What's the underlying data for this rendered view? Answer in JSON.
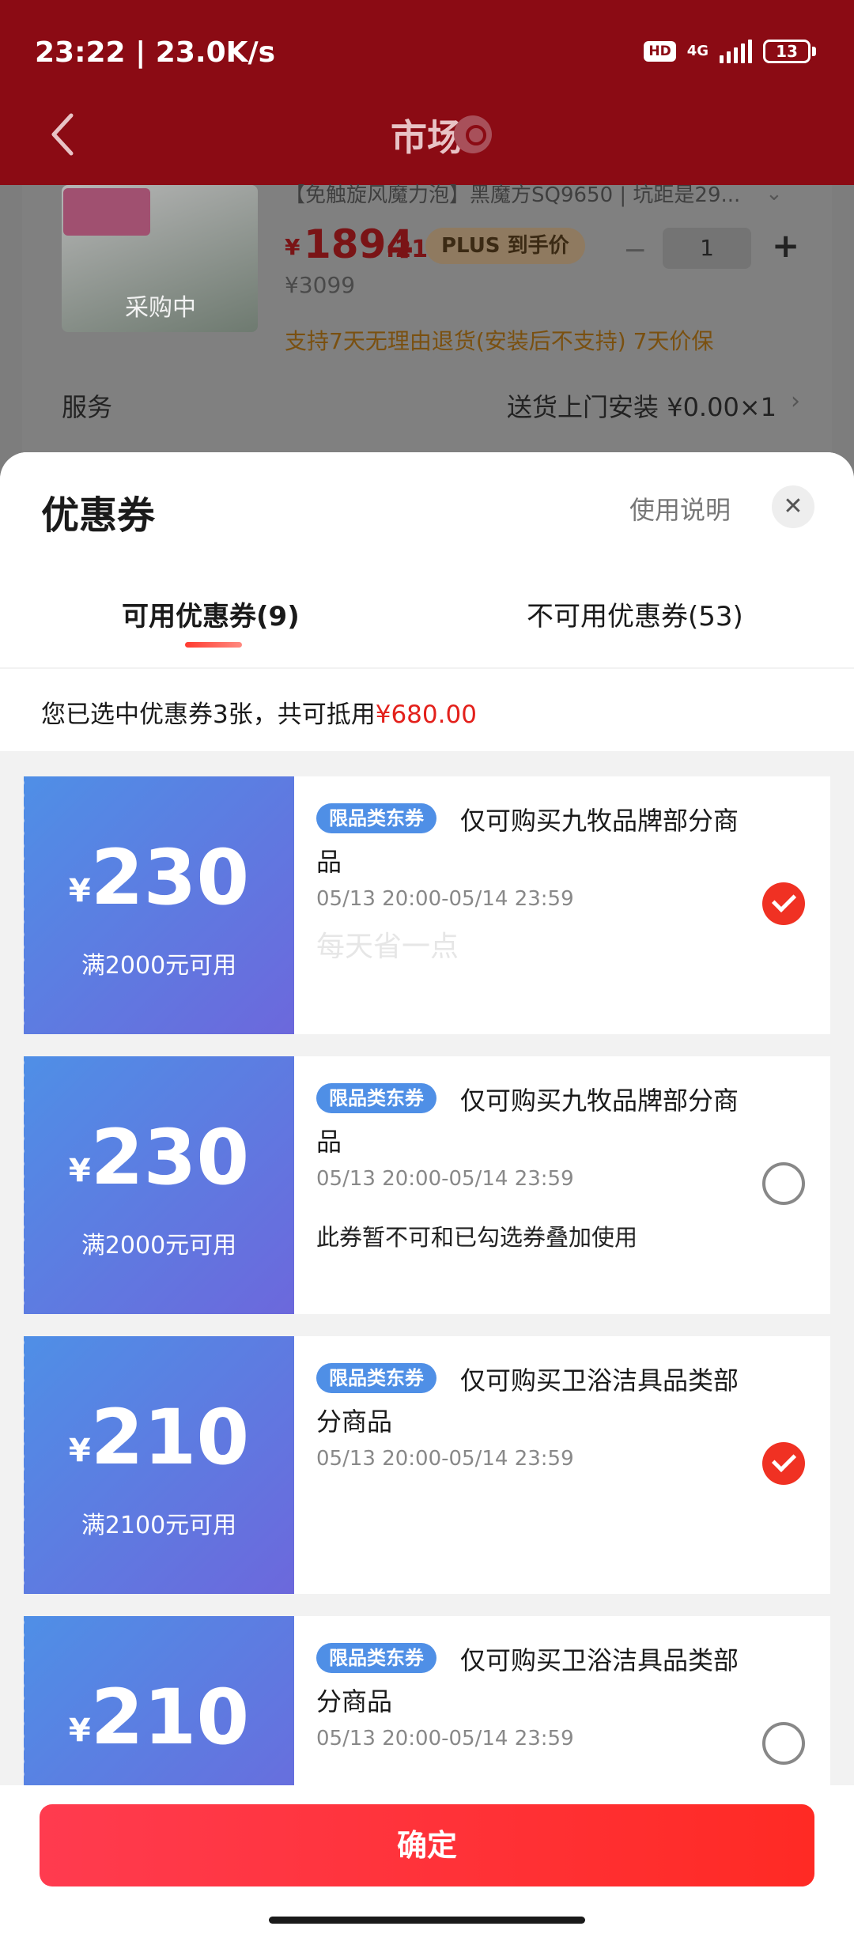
{
  "status_bar": {
    "time": "23:22 | 23.0K/s",
    "hd": "HD",
    "network": "4G",
    "battery": "13"
  },
  "nav": {
    "title": "市场",
    "back_icon": "back-arrow-icon",
    "location_icon": "location-icon"
  },
  "background_product": {
    "title": "【免触旋风魔力泡】黑魔方SQ9650 | 坑距是29...",
    "image_text": "采购中",
    "price_symbol": "¥",
    "price_int": "1894",
    "price_dec": ".21",
    "plus_label": "PLUS 到手价",
    "orig_price": "¥3099",
    "quantity": "1",
    "minus": "−",
    "plus": "+",
    "return_policy": "支持7天无理由退货(安装后不支持)  7天价保",
    "service_label": "服务",
    "service_value": "送货上门安装  ¥0.00×1"
  },
  "sheet": {
    "title": "优惠券",
    "help": "使用说明",
    "close": "✕",
    "tabs": [
      {
        "label": "可用优惠券(9)",
        "active": true
      },
      {
        "label": "不可用优惠券(53)",
        "active": false
      }
    ],
    "summary_prefix": "您已选中优惠券3张，共可抵用",
    "summary_amount": "¥680.00",
    "accent_color": "#e3201b"
  },
  "coupons": [
    {
      "symbol": "¥",
      "amount": "230",
      "condition": "满2000元可用",
      "tag": "限品类东券",
      "desc": "仅可购买九牧品牌部分商品",
      "date": "05/13 20:00-05/14 23:59",
      "note": "",
      "watermark": "每天省一点",
      "checked": true
    },
    {
      "symbol": "¥",
      "amount": "230",
      "condition": "满2000元可用",
      "tag": "限品类东券",
      "desc": "仅可购买九牧品牌部分商品",
      "date": "05/13 20:00-05/14 23:59",
      "note": "此券暂不可和已勾选券叠加使用",
      "watermark": "",
      "checked": false
    },
    {
      "symbol": "¥",
      "amount": "210",
      "condition": "满2100元可用",
      "tag": "限品类东券",
      "desc": "仅可购买卫浴洁具品类部分商品",
      "date": "05/13 20:00-05/14 23:59",
      "note": "",
      "watermark": "",
      "checked": true
    },
    {
      "symbol": "¥",
      "amount": "210",
      "condition": "",
      "tag": "限品类东券",
      "desc": "仅可购买卫浴洁具品类部分商品",
      "date": "05/13 20:00-05/14 23:59",
      "note": "",
      "watermark": "",
      "checked": false
    }
  ],
  "confirm": {
    "label": "确定"
  }
}
